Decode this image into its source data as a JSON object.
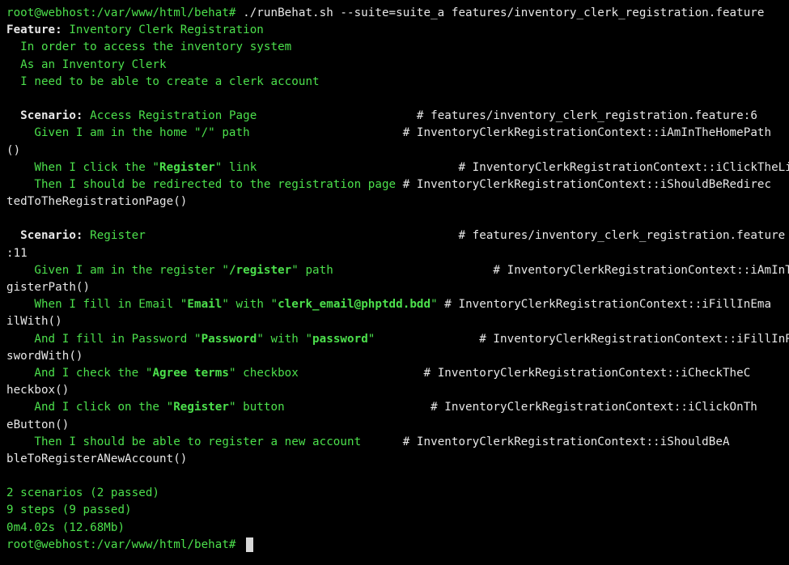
{
  "terminal": {
    "prompt": "root@webhost:/var/www/html/behat#",
    "command": " ./runBehat.sh --suite=suite_a features/inventory_clerk_registration.feature",
    "feature": {
      "keyword": "Feature:",
      "title": " Inventory Clerk Registration",
      "narrative": [
        "  In order to access the inventory system",
        "  As an Inventory Clerk",
        "  I need to be able to create a clerk account"
      ]
    },
    "scenario1": {
      "keyword": "  Scenario:",
      "title": " Access Registration Page                       ",
      "comment": "# features/inventory_clerk_registration.feature:6",
      "steps": {
        "s1_text": "    Given I am in the home \"/\" path                      ",
        "s1_comment": "# InventoryClerkRegistrationContext::iAmInTheHomePath",
        "s1_wrap": "()",
        "s2_pre": "    When I click the \"",
        "s2_bold": "Register",
        "s2_post": "\" link                             ",
        "s2_comment": "# InventoryClerkRegistrationContext::iClickTheLink()",
        "s3_text": "    Then I should be redirected to the registration page ",
        "s3_comment": "# InventoryClerkRegistrationContext::iShouldBeRedirec",
        "s3_wrap": "tedToTheRegistrationPage()"
      }
    },
    "scenario2": {
      "keyword": "  Scenario:",
      "title": " Register                                             ",
      "comment": "# features/inventory_clerk_registration.feature",
      "comment_wrap": ":11",
      "steps": {
        "s1_pre": "    Given I am in the register \"",
        "s1_bold": "/register",
        "s1_post": "\" path                       ",
        "s1_comment": "# InventoryClerkRegistrationContext::iAmInTheRe",
        "s1_wrap": "gisterPath()",
        "s2_pre": "    When I fill in Email \"",
        "s2_bold1": "Email",
        "s2_mid": "\" with \"",
        "s2_bold2": "clerk_email@phptdd.bdd",
        "s2_post": "\" ",
        "s2_comment": "# InventoryClerkRegistrationContext::iFillInEma",
        "s2_wrap": "ilWith()",
        "s3_pre": "    And I fill in Password \"",
        "s3_bold1": "Password",
        "s3_mid": "\" with \"",
        "s3_bold2": "password",
        "s3_post": "\"               ",
        "s3_comment": "# InventoryClerkRegistrationContext::iFillInPas",
        "s3_wrap": "swordWith()",
        "s4_pre": "    And I check the \"",
        "s4_bold": "Agree terms",
        "s4_post": "\" checkbox                  ",
        "s4_comment": "# InventoryClerkRegistrationContext::iCheckTheC",
        "s4_wrap": "heckbox()",
        "s5_pre": "    And I click on the \"",
        "s5_bold": "Register",
        "s5_post": "\" button                     ",
        "s5_comment": "# InventoryClerkRegistrationContext::iClickOnTh",
        "s5_wrap": "eButton()",
        "s6_text": "    Then I should be able to register a new account      ",
        "s6_comment": "# InventoryClerkRegistrationContext::iShouldBeA",
        "s6_wrap": "bleToRegisterANewAccount()"
      }
    },
    "summary": {
      "scenarios": "2 scenarios (2 passed)",
      "steps": "9 steps (9 passed)",
      "time": "0m4.02s (12.68Mb)"
    },
    "final_prompt": "root@webhost:/var/www/html/behat# "
  }
}
